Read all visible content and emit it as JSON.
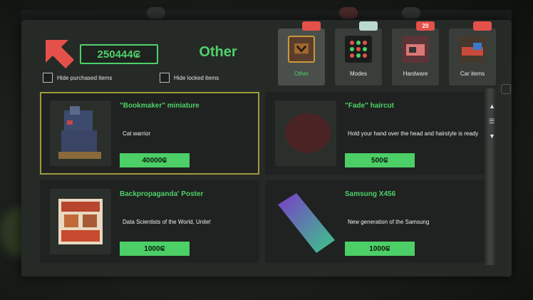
{
  "header": {
    "balance": "250444₢",
    "category_title": "Other"
  },
  "filters": {
    "hide_purchased_label": "Hide purchased items",
    "hide_locked_label": "Hide locked items"
  },
  "tabs": [
    {
      "label": "Other",
      "badge": "",
      "icon": "box-icon",
      "active": true
    },
    {
      "label": "Modes",
      "badge": "",
      "icon": "dots-icon",
      "active": false
    },
    {
      "label": "Hardware",
      "badge": "20",
      "icon": "hardware-icon",
      "active": false
    },
    {
      "label": "Car items",
      "badge": "",
      "icon": "car-icon",
      "active": false
    }
  ],
  "items": [
    {
      "name": "\"Bookmaker\" miniature",
      "description": "Cat warrior",
      "price": "40000₢",
      "selected": true,
      "icon": "robot-miniature-icon"
    },
    {
      "name": "\"Fade\" haircut",
      "description": "Hold your hand over the head and hairstyle is ready",
      "price": "500₢",
      "selected": false,
      "icon": "haircut-icon"
    },
    {
      "name": "Backpropaganda' Poster",
      "description": "Data Scientists of the World, Unite!",
      "price": "1000₢",
      "selected": false,
      "icon": "poster-icon"
    },
    {
      "name": "Samsung X456",
      "description": "New generation of the Samsung",
      "price": "1000₢",
      "selected": false,
      "icon": "phone-icon"
    }
  ],
  "colors": {
    "accent_green": "#4fd069",
    "badge_red": "#e4514a",
    "selected_border": "#9f9a3e"
  }
}
